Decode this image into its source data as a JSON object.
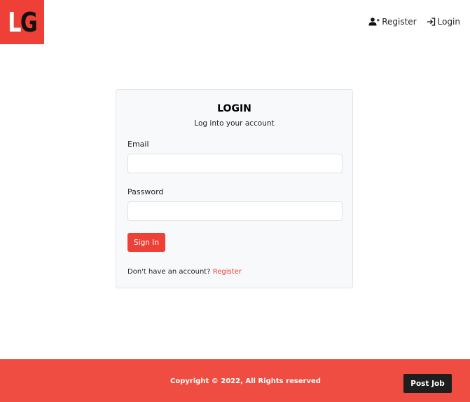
{
  "header": {
    "logo": {
      "letter1": "L",
      "letter2": "G",
      "color": "#ee4036"
    },
    "nav": {
      "register": {
        "label": "Register",
        "icon": "user-plus-icon"
      },
      "login": {
        "label": "Login",
        "icon": "sign-in-icon"
      }
    }
  },
  "login_card": {
    "title": "LOGIN",
    "subtitle": "Log into your account",
    "email": {
      "label": "Email",
      "value": "",
      "placeholder": ""
    },
    "password": {
      "label": "Password",
      "value": "",
      "placeholder": ""
    },
    "submit_label": "Sign In",
    "register_prompt": "Don't have an account?",
    "register_link": "Register"
  },
  "footer": {
    "copyright": "Copyright © 2022, All Rights reserved",
    "post_job_label": "Post Job",
    "background": "#ef4d41"
  },
  "colors": {
    "accent": "#ee4036",
    "dark_button": "#1e1e1e",
    "card_background": "#f8f9fa"
  }
}
